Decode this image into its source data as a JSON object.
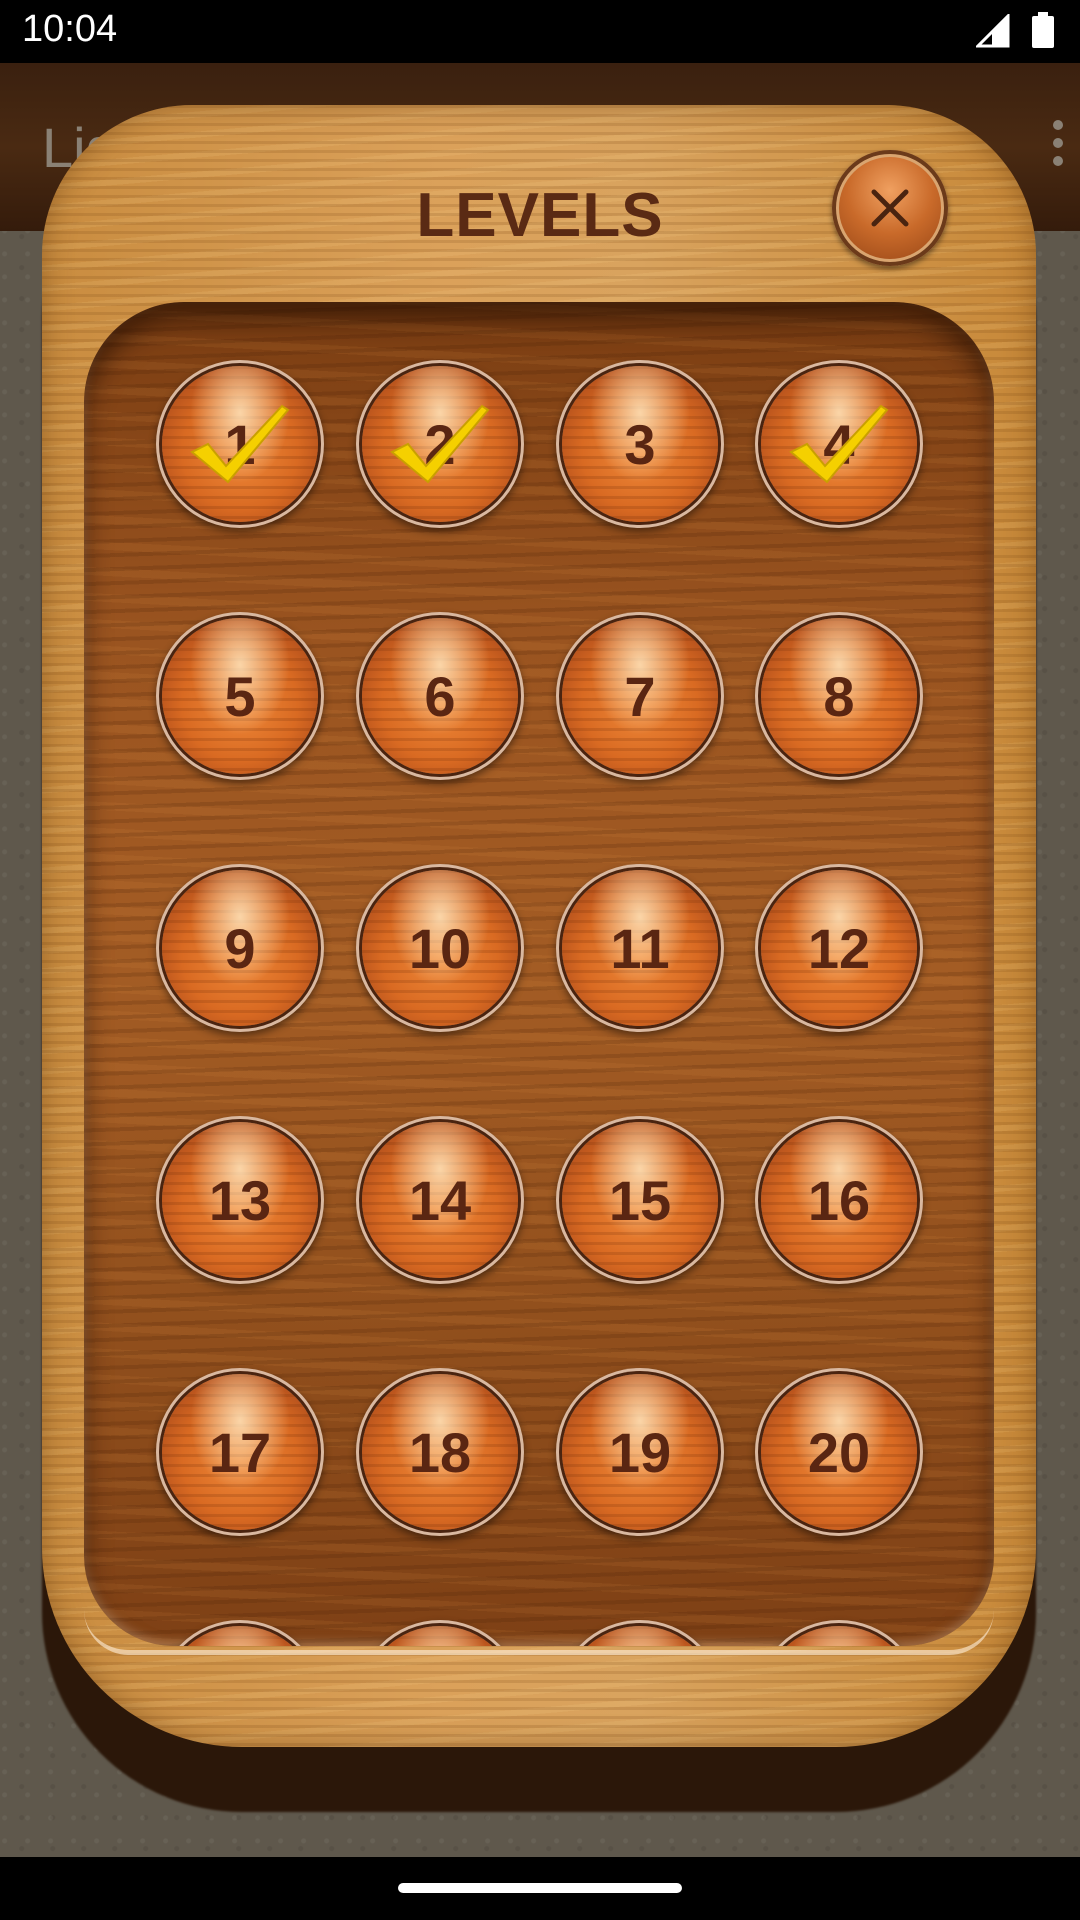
{
  "status_bar": {
    "time": "10:04"
  },
  "app": {
    "title_partial": "Lig"
  },
  "dialog": {
    "title": "LEVELS",
    "levels": [
      {
        "label": "1",
        "completed": true
      },
      {
        "label": "2",
        "completed": true
      },
      {
        "label": "3",
        "completed": false
      },
      {
        "label": "4",
        "completed": true
      },
      {
        "label": "5",
        "completed": false
      },
      {
        "label": "6",
        "completed": false
      },
      {
        "label": "7",
        "completed": false
      },
      {
        "label": "8",
        "completed": false
      },
      {
        "label": "9",
        "completed": false
      },
      {
        "label": "10",
        "completed": false
      },
      {
        "label": "11",
        "completed": false
      },
      {
        "label": "12",
        "completed": false
      },
      {
        "label": "13",
        "completed": false
      },
      {
        "label": "14",
        "completed": false
      },
      {
        "label": "15",
        "completed": false
      },
      {
        "label": "16",
        "completed": false
      },
      {
        "label": "17",
        "completed": false
      },
      {
        "label": "18",
        "completed": false
      },
      {
        "label": "19",
        "completed": false
      },
      {
        "label": "20",
        "completed": false
      }
    ]
  },
  "colors": {
    "wood_frame": "#d9a35e",
    "panel": "#9a5420",
    "button": "#d96a22",
    "text": "#5a2a14",
    "check": "#f5d000"
  }
}
